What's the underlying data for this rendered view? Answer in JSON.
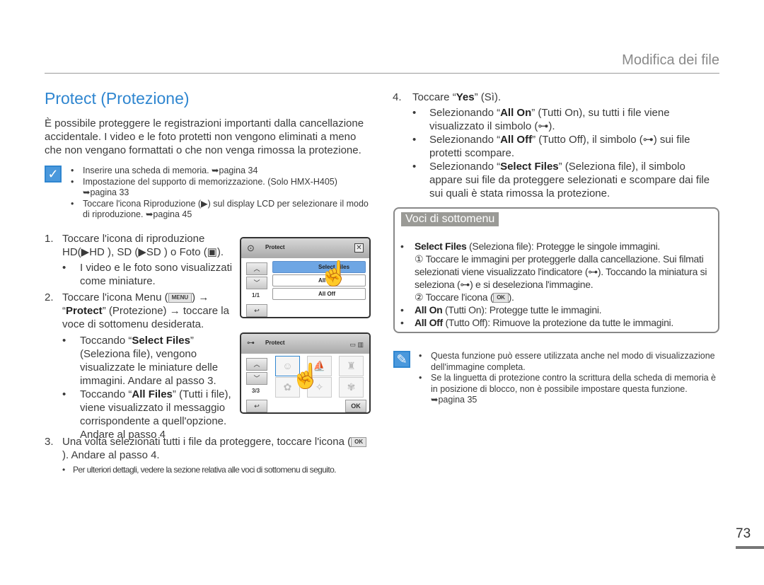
{
  "header": {
    "section": "Modifica dei file",
    "page_number": "73"
  },
  "title": "Protect (Protezione)",
  "intro": "È possibile proteggere le registrazioni importanti dalla cancellazione accidentale. I video e le foto protetti non vengono eliminati a meno che non vengano formattati o che non venga rimossa la protezione.",
  "prereq": [
    "Inserire una scheda di memoria. ➥pagina 34",
    "Impostazione del supporto di memorizzazione. (Solo HMX-H405) ➥pagina 33",
    "Toccare l'icona Riproduzione (▶) sul display LCD per selezionare il modo di riproduzione. ➥pagina 45"
  ],
  "steps": {
    "s1_num": "1.",
    "s1a": "Toccare l'icona di riproduzione",
    "s1b": "HD(▶HD ), SD (▶SD ) o Foto (▣).",
    "s1_bullet": "I video e le foto sono visualizzati come miniature.",
    "s2_num": "2.",
    "s2a": "Toccare l'icona Menu (",
    "s2_menu": "MENU",
    "s2b": ") → “",
    "s2_bold": "Protect",
    "s2c": "” (Protezione) → toccare la voce di sottomenu desiderata.",
    "s2_b1a": "Toccando “",
    "s2_b1bold": "Select Files",
    "s2_b1b": "” (Seleziona file), vengono visualizzate le miniature delle immagini. Andare al passo 3.",
    "s2_b2a": "Toccando “",
    "s2_b2bold": "All Files",
    "s2_b2b": "” (Tutti i file), viene visualizzato il messaggio corrispondente a quell'opzione. Andare al passo 4",
    "s3_num": "3.",
    "s3a": "Una volta selezionati tutti i file da proteggere, toccare l'icona (",
    "s3_ok": "OK",
    "s3b": "). Andare al passo 4.",
    "s3_bullet": "Per ulteriori dettagli, vedere la sezione relativa alle voci di sottomenu di seguito.",
    "s4_num": "4.",
    "s4a": "Toccare “",
    "s4_bold": "Yes",
    "s4b": "” (Sì).",
    "s4_b1a": "Selezionando “",
    "s4_b1bold": "All On",
    "s4_b1b": "” (Tutti On), su tutti i file viene visualizzato il simbolo (⊶).",
    "s4_b2a": "Selezionando “",
    "s4_b2bold": "All Off",
    "s4_b2b": "” (Tutto Off), il simbolo (⊶) sui file protetti scompare.",
    "s4_b3a": "Selezionando “",
    "s4_b3bold": "Select Files",
    "s4_b3b": "” (Seleziona file), il simbolo appare sui file da proteggere selezionati e scompare dai file sui quali è stata rimossa la protezione."
  },
  "screen1": {
    "title": "Protect",
    "items": [
      "Select Files",
      "All On",
      "All Off"
    ],
    "page": "1/1"
  },
  "screen2": {
    "title": "Protect",
    "page": "3/3",
    "ok": "OK"
  },
  "submenu": {
    "title": "Voci di sottomenu",
    "i1_bold": "Select Files",
    "i1": " (Seleziona file): Protegge le singole immagini.",
    "i1_1": "① Toccare le immagini per proteggerle dalla cancellazione. Sui filmati selezionati viene visualizzato l'indicatore (⊶). Toccando la miniatura si seleziona (⊶) e si deseleziona l'immagine.",
    "i1_2a": "② Toccare l'icona (",
    "i1_2ok": "OK",
    "i1_2b": ").",
    "i2_bold": "All On",
    "i2": " (Tutti On): Protegge tutte le immagini.",
    "i3_bold": "All Off",
    "i3": " (Tutto Off): Rimuove la protezione da tutte le immagini."
  },
  "notes": [
    "Questa funzione può essere utilizzata anche nel modo di visualizzazione dell'immagine completa.",
    "Se la linguetta di protezione contro la scrittura della scheda di memoria è in posizione di blocco, non è possibile impostare questa funzione. ➥pagina 35"
  ],
  "colors": {
    "accent": "#2f86d0",
    "submenu_tab": "#9a9a96"
  }
}
